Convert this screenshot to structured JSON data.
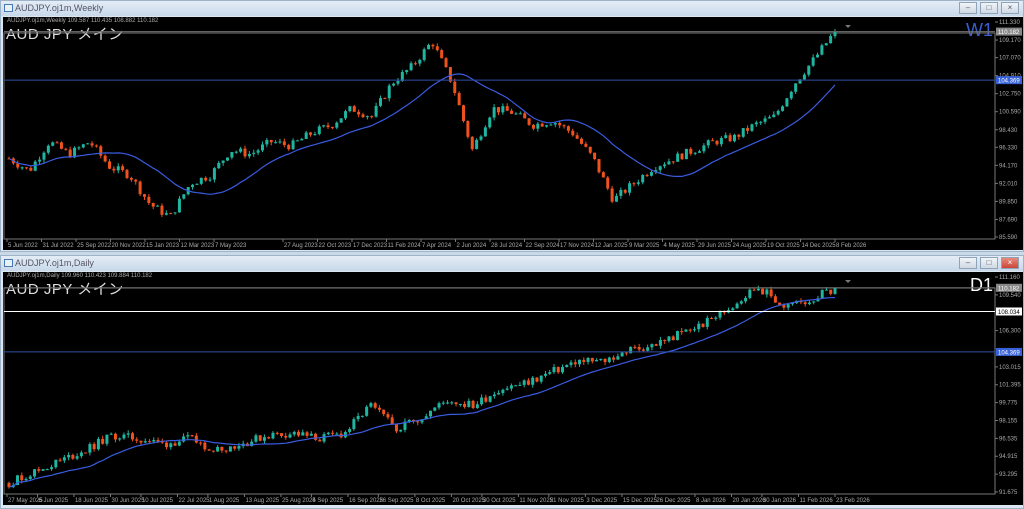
{
  "windows": [
    {
      "title": "AUDJPY.oj1m,Weekly",
      "info": "AUDJPY.oj1m,Weekly  109.587 110.435 108.882 110.182",
      "symbol": "AUD JPY   メイン",
      "timeframe": "W1",
      "timeframe_color": "#3a5fd0",
      "price_axis": [
        "111.330",
        "109.170",
        "107.070",
        "104.910",
        "102.750",
        "100.590",
        "98.430",
        "96.330",
        "94.170",
        "92.010",
        "89.850",
        "87.690",
        "85.590"
      ],
      "price_range": [
        85.59,
        111.33
      ],
      "lines": [
        {
          "price": 110.182,
          "label": "110.182",
          "color": "#707070",
          "type": "bid"
        },
        {
          "price": 104.369,
          "label": "104.369",
          "color": "#2f4fa8",
          "type": "level"
        }
      ],
      "time_axis": [
        "5 Jun 2022",
        "31 Jul 2022",
        "25 Sep 2022",
        "20 Nov 2022",
        "15 Jan 2023",
        "12 Mar 2023",
        "7 May 2023",
        "27 Aug 2023",
        "22 Oct 2023",
        "17 Dec 2023",
        "11 Feb 2024",
        "7 Apr 2024",
        "2 Jun 2024",
        "28 Jul 2024",
        "22 Sep 2024",
        "17 Nov 2024",
        "12 Jan 2025",
        "9 Mar 2025",
        "4 May 2025",
        "29 Jun 2025",
        "24 Aug 2025",
        "19 Oct 2025",
        "14 Dec 2025",
        "8 Feb 2026"
      ],
      "candles": 190,
      "anchors": [
        95,
        93.5,
        97,
        95.5,
        97,
        94,
        93,
        89.5,
        88,
        92,
        93,
        96,
        95.5,
        97,
        96.5,
        98,
        99,
        101,
        100,
        104,
        106,
        109,
        104,
        96,
        101,
        100.5,
        99,
        99.5,
        98,
        95,
        90,
        92,
        94,
        95,
        96,
        97,
        97.5,
        99,
        100,
        104,
        107,
        110.2
      ]
    },
    {
      "title": "AUDJPY.oj1m,Daily",
      "info": "AUDJPY.oj1m,Daily  109.960 110.423 109.884 110.182",
      "symbol": "AUD JPY   メイン",
      "timeframe": "D1",
      "timeframe_color": "#ffffff",
      "price_axis": [
        "111.160",
        "109.540",
        "106.300",
        "103.015",
        "101.395",
        "99.775",
        "98.155",
        "96.535",
        "94.915",
        "93.295",
        "91.675"
      ],
      "price_range": [
        91.675,
        111.16
      ],
      "lines": [
        {
          "price": 110.182,
          "label": "110.182",
          "color": "#707070",
          "type": "bid"
        },
        {
          "price": 108.034,
          "label": "108.034",
          "color": "#ffffff",
          "type": "level"
        },
        {
          "price": 104.369,
          "label": "104.369",
          "color": "#2f4fa8",
          "type": "level"
        }
      ],
      "time_axis": [
        "27 May 2025",
        "6 Jun 2025",
        "18 Jun 2025",
        "30 Jun 2025",
        "10 Jul 2025",
        "22 Jul 2025",
        "1 Aug 2025",
        "13 Aug 2025",
        "25 Aug 2025",
        "4 Sep 2025",
        "16 Sep 2025",
        "26 Sep 2025",
        "8 Oct 2025",
        "20 Oct 2025",
        "30 Oct 2025",
        "11 Nov 2025",
        "21 Nov 2025",
        "3 Dec 2025",
        "15 Dec 2025",
        "26 Dec 2025",
        "8 Jan 2026",
        "20 Jan 2026",
        "30 Jan 2026",
        "11 Feb 2026",
        "23 Feb 2026"
      ],
      "candles": 195,
      "anchors": [
        92.5,
        93.5,
        94.5,
        95.5,
        96.8,
        96.5,
        96,
        96.5,
        95.5,
        96,
        96.8,
        97,
        96.5,
        97,
        99.5,
        97.5,
        98.5,
        100,
        99.5,
        101,
        101.5,
        102.5,
        103.5,
        103.5,
        104.5,
        105,
        106,
        107,
        108.5,
        110.3,
        108.5,
        109,
        110.2
      ]
    }
  ],
  "colors": {
    "bull": "#1fb5a0",
    "bear": "#f0521e",
    "ma": "#3a5ce0"
  }
}
